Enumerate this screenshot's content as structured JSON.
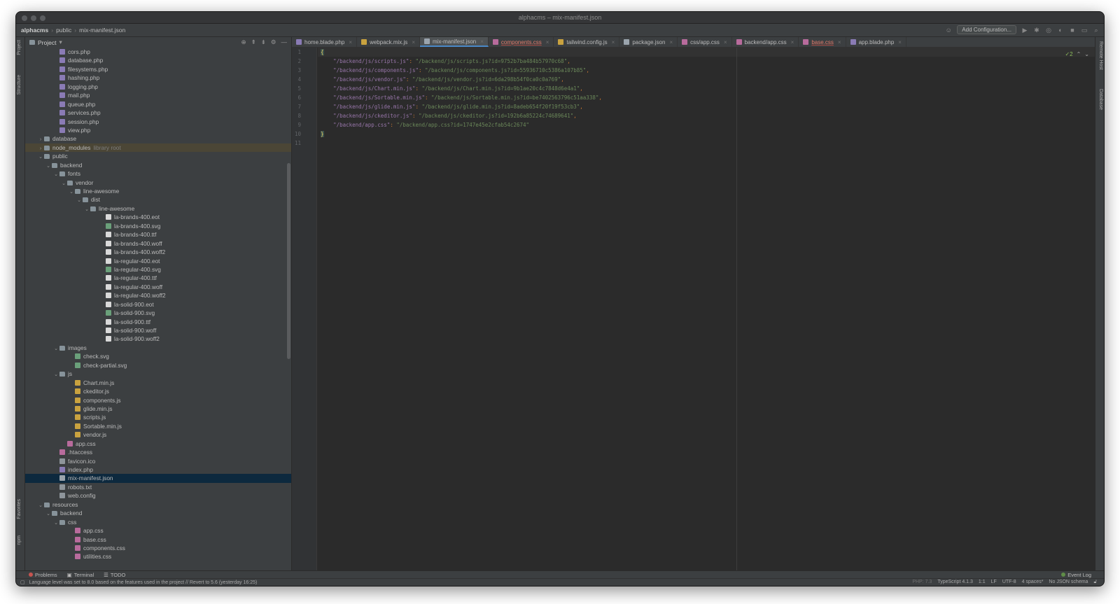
{
  "window": {
    "title": "alphacms – mix-manifest.json"
  },
  "breadcrumb": [
    "alphacms",
    "public",
    "mix-manifest.json"
  ],
  "toolbar": {
    "add_configuration": "Add Configuration..."
  },
  "side_strips": {
    "project": "Project",
    "structure": "Structure",
    "favorites": "Favorites",
    "npm": "npm",
    "remote_host": "Remote Host",
    "database": "Database"
  },
  "project_panel": {
    "title": "Project",
    "tree": [
      {
        "label": "cors.php",
        "depth": 3,
        "icon": "php"
      },
      {
        "label": "database.php",
        "depth": 3,
        "icon": "php"
      },
      {
        "label": "filesystems.php",
        "depth": 3,
        "icon": "php"
      },
      {
        "label": "hashing.php",
        "depth": 3,
        "icon": "php"
      },
      {
        "label": "logging.php",
        "depth": 3,
        "icon": "php"
      },
      {
        "label": "mail.php",
        "depth": 3,
        "icon": "php"
      },
      {
        "label": "queue.php",
        "depth": 3,
        "icon": "php"
      },
      {
        "label": "services.php",
        "depth": 3,
        "icon": "php"
      },
      {
        "label": "session.php",
        "depth": 3,
        "icon": "php"
      },
      {
        "label": "view.php",
        "depth": 3,
        "icon": "php"
      },
      {
        "label": "database",
        "depth": 1,
        "icon": "folder",
        "arrow": "right"
      },
      {
        "label": "node_modules",
        "depth": 1,
        "icon": "folder",
        "arrow": "right",
        "extra": "library root",
        "highlight": true
      },
      {
        "label": "public",
        "depth": 1,
        "icon": "folder",
        "arrow": "down"
      },
      {
        "label": "backend",
        "depth": 2,
        "icon": "folder",
        "arrow": "down"
      },
      {
        "label": "fonts",
        "depth": 3,
        "icon": "folder",
        "arrow": "down"
      },
      {
        "label": "vendor",
        "depth": 4,
        "icon": "folder",
        "arrow": "down"
      },
      {
        "label": "line-awesome",
        "depth": 5,
        "icon": "folder",
        "arrow": "down"
      },
      {
        "label": "dist",
        "depth": 6,
        "icon": "folder",
        "arrow": "down"
      },
      {
        "label": "line-awesome",
        "depth": 7,
        "icon": "folder",
        "arrow": "down"
      },
      {
        "label": "la-brands-400.eot",
        "depth": 9,
        "icon": "file"
      },
      {
        "label": "la-brands-400.svg",
        "depth": 9,
        "icon": "svgf"
      },
      {
        "label": "la-brands-400.ttf",
        "depth": 9,
        "icon": "file"
      },
      {
        "label": "la-brands-400.woff",
        "depth": 9,
        "icon": "file"
      },
      {
        "label": "la-brands-400.woff2",
        "depth": 9,
        "icon": "file"
      },
      {
        "label": "la-regular-400.eot",
        "depth": 9,
        "icon": "file"
      },
      {
        "label": "la-regular-400.svg",
        "depth": 9,
        "icon": "svgf"
      },
      {
        "label": "la-regular-400.ttf",
        "depth": 9,
        "icon": "file"
      },
      {
        "label": "la-regular-400.woff",
        "depth": 9,
        "icon": "file"
      },
      {
        "label": "la-regular-400.woff2",
        "depth": 9,
        "icon": "file"
      },
      {
        "label": "la-solid-900.eot",
        "depth": 9,
        "icon": "file"
      },
      {
        "label": "la-solid-900.svg",
        "depth": 9,
        "icon": "svgf"
      },
      {
        "label": "la-solid-900.ttf",
        "depth": 9,
        "icon": "file"
      },
      {
        "label": "la-solid-900.woff",
        "depth": 9,
        "icon": "file"
      },
      {
        "label": "la-solid-900.woff2",
        "depth": 9,
        "icon": "file"
      },
      {
        "label": "images",
        "depth": 3,
        "icon": "folder",
        "arrow": "down"
      },
      {
        "label": "check.svg",
        "depth": 5,
        "icon": "svgf"
      },
      {
        "label": "check-partial.svg",
        "depth": 5,
        "icon": "svgf"
      },
      {
        "label": "js",
        "depth": 3,
        "icon": "folder",
        "arrow": "down"
      },
      {
        "label": "Chart.min.js",
        "depth": 5,
        "icon": "js"
      },
      {
        "label": "ckeditor.js",
        "depth": 5,
        "icon": "js"
      },
      {
        "label": "components.js",
        "depth": 5,
        "icon": "js"
      },
      {
        "label": "glide.min.js",
        "depth": 5,
        "icon": "js"
      },
      {
        "label": "scripts.js",
        "depth": 5,
        "icon": "js"
      },
      {
        "label": "Sortable.min.js",
        "depth": 5,
        "icon": "js"
      },
      {
        "label": "vendor.js",
        "depth": 5,
        "icon": "js"
      },
      {
        "label": "app.css",
        "depth": 4,
        "icon": "css"
      },
      {
        "label": ".htaccess",
        "depth": 3,
        "icon": "css"
      },
      {
        "label": "favicon.ico",
        "depth": 3,
        "icon": "gen"
      },
      {
        "label": "index.php",
        "depth": 3,
        "icon": "php"
      },
      {
        "label": "mix-manifest.json",
        "depth": 3,
        "icon": "json",
        "selected": true
      },
      {
        "label": "robots.txt",
        "depth": 3,
        "icon": "gen"
      },
      {
        "label": "web.config",
        "depth": 3,
        "icon": "gen"
      },
      {
        "label": "resources",
        "depth": 1,
        "icon": "folder",
        "arrow": "down"
      },
      {
        "label": "backend",
        "depth": 2,
        "icon": "folder",
        "arrow": "down"
      },
      {
        "label": "css",
        "depth": 3,
        "icon": "folder",
        "arrow": "down"
      },
      {
        "label": "app.css",
        "depth": 5,
        "icon": "css"
      },
      {
        "label": "base.css",
        "depth": 5,
        "icon": "css"
      },
      {
        "label": "components.css",
        "depth": 5,
        "icon": "css"
      },
      {
        "label": "utilities.css",
        "depth": 5,
        "icon": "css"
      }
    ]
  },
  "tabs": [
    {
      "label": "home.blade.php",
      "icon": "php"
    },
    {
      "label": "webpack.mix.js",
      "icon": "js"
    },
    {
      "label": "mix-manifest.json",
      "icon": "json",
      "active": true
    },
    {
      "label": "components.css",
      "icon": "css",
      "modified": true
    },
    {
      "label": "tailwind.config.js",
      "icon": "js"
    },
    {
      "label": "package.json",
      "icon": "json"
    },
    {
      "label": "css/app.css",
      "icon": "css"
    },
    {
      "label": "backend/app.css",
      "icon": "css"
    },
    {
      "label": "base.css",
      "icon": "css",
      "modified": true
    },
    {
      "label": "app.blade.php",
      "icon": "php"
    }
  ],
  "editor": {
    "line_numbers": [
      "1",
      "2",
      "3",
      "4",
      "5",
      "6",
      "7",
      "8",
      "9",
      "10",
      "11"
    ],
    "entries": [
      {
        "key": "\"/backend/js/scripts.js\"",
        "value": "\"/backend/js/scripts.js?id=9752b7ba484b57970c68\"",
        "comma": ","
      },
      {
        "key": "\"/backend/js/components.js\"",
        "value": "\"/backend/js/components.js?id=55936710c5386a107b85\"",
        "comma": ","
      },
      {
        "key": "\"/backend/js/vendor.js\"",
        "value": "\"/backend/js/vendor.js?id=6da298b54f0ca0c0a769\"",
        "comma": ","
      },
      {
        "key": "\"/backend/js/Chart.min.js\"",
        "value": "\"/backend/js/Chart.min.js?id=9b1ae20c4c7848d6e4a1\"",
        "comma": ","
      },
      {
        "key": "\"/backend/js/Sortable.min.js\"",
        "value": "\"/backend/js/Sortable.min.js?id=be7402563796c51aa338\"",
        "comma": ","
      },
      {
        "key": "\"/backend/js/glide.min.js\"",
        "value": "\"/backend/js/glide.min.js?id=8adeb654f20f19f53cb3\"",
        "comma": ","
      },
      {
        "key": "\"/backend/js/ckeditor.js\"",
        "value": "\"/backend/js/ckeditor.js?id=192b6a85224c74689641\"",
        "comma": ","
      },
      {
        "key": "\"/backend/app.css\"",
        "value": "\"/backend/app.css?id=1747e45e2cfab54c2674\"",
        "comma": ""
      }
    ],
    "open_brace": "{",
    "close_brace": "}",
    "inspection_count": "2"
  },
  "bottom_tools": {
    "problems": "Problems",
    "terminal": "Terminal",
    "todo": "TODO",
    "event_log": "Event Log"
  },
  "status": {
    "message": "Language level was set to 8.0 based on the features used in the project // Revert to 5.6 (yesterday 16:25)",
    "php": "PHP: 7.3",
    "typescript": "TypeScript 4.1.3",
    "position": "1:1",
    "line_sep": "LF",
    "encoding": "UTF-8",
    "indent": "4 spaces*",
    "schema": "No JSON schema"
  }
}
